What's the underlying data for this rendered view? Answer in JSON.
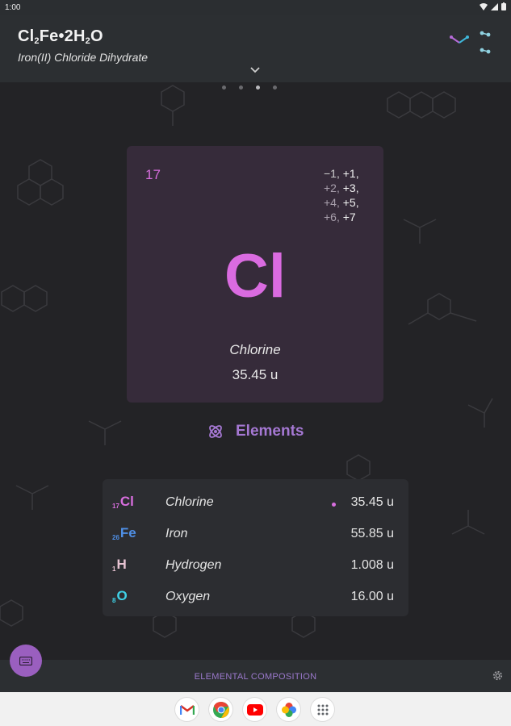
{
  "status": {
    "time": "1:00"
  },
  "header": {
    "formula_parts": {
      "cl": "Cl",
      "cl_sub": "2",
      "fe": "Fe•2H",
      "h_sub": "2",
      "o": "O"
    },
    "compound_name": "Iron(II) Chloride Dihydrate"
  },
  "pager": {
    "count": 4,
    "active_index": 2
  },
  "element_card": {
    "atomic_number": "17",
    "oxidation_lines": [
      {
        "a": "−1,",
        "b": " +1,"
      },
      {
        "a": "+2,",
        "b": " +3,"
      },
      {
        "a": "+4,",
        "b": " +5,"
      },
      {
        "a": "+6,",
        "b": " +7"
      }
    ],
    "symbol": "Cl",
    "name": "Chlorine",
    "mass": "35.45 u"
  },
  "section": {
    "title": "Elements"
  },
  "elements": [
    {
      "number": "17",
      "symbol": "Cl",
      "name": "Chlorine",
      "mass": "35.45 u",
      "color": "#d86ede",
      "selected": true
    },
    {
      "number": "26",
      "symbol": "Fe",
      "name": "Iron",
      "mass": "55.85 u",
      "color": "#4f8fe6",
      "selected": false
    },
    {
      "number": "1",
      "symbol": "H",
      "name": "Hydrogen",
      "mass": "1.008 u",
      "color": "#e7c3d2",
      "selected": false
    },
    {
      "number": "8",
      "symbol": "O",
      "name": "Oxygen",
      "mass": "16.00 u",
      "color": "#3fd1e6",
      "selected": false
    }
  ],
  "bottom_bar": {
    "caption": "ELEMENTAL COMPOSITION"
  },
  "dock_apps": [
    "gmail-icon",
    "chrome-icon",
    "youtube-icon",
    "photos-icon",
    "app-drawer-icon"
  ],
  "colors": {
    "accent": "#a578d3",
    "symbol": "#da6be0",
    "card_bg": "#362b3a",
    "background": "#232326"
  }
}
